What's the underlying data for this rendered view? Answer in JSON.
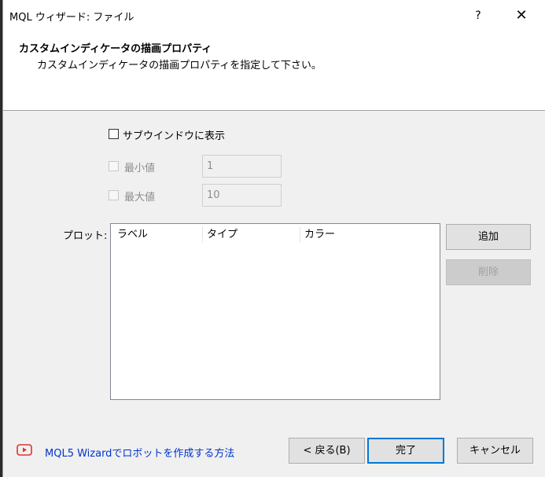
{
  "window": {
    "title": "MQL ウィザード: ファイル",
    "help_label": "?",
    "close_label": "✕"
  },
  "header": {
    "title": "カスタムインディケータの描画プロパティ",
    "subtitle": "カスタムインディケータの描画プロパティを指定して下さい。"
  },
  "options": {
    "subwindow_label": "サブウインドウに表示",
    "subwindow_checked": false,
    "min_label": "最小値",
    "min_value": "1",
    "max_label": "最大値",
    "max_value": "10"
  },
  "plots": {
    "label": "プロット:",
    "columns": [
      "ラベル",
      "タイプ",
      "カラー"
    ],
    "rows": []
  },
  "buttons": {
    "add": "追加",
    "delete": "削除",
    "back": "< 戻る(B)",
    "finish": "完了",
    "cancel": "キャンセル"
  },
  "footer": {
    "link_text": "MQL5 Wizardでロボットを作成する方法",
    "link_icon": "youtube-play-icon"
  },
  "colors": {
    "link": "#0033cc",
    "default_button_border": "#0078d7",
    "icon_red": "#e0322c"
  }
}
